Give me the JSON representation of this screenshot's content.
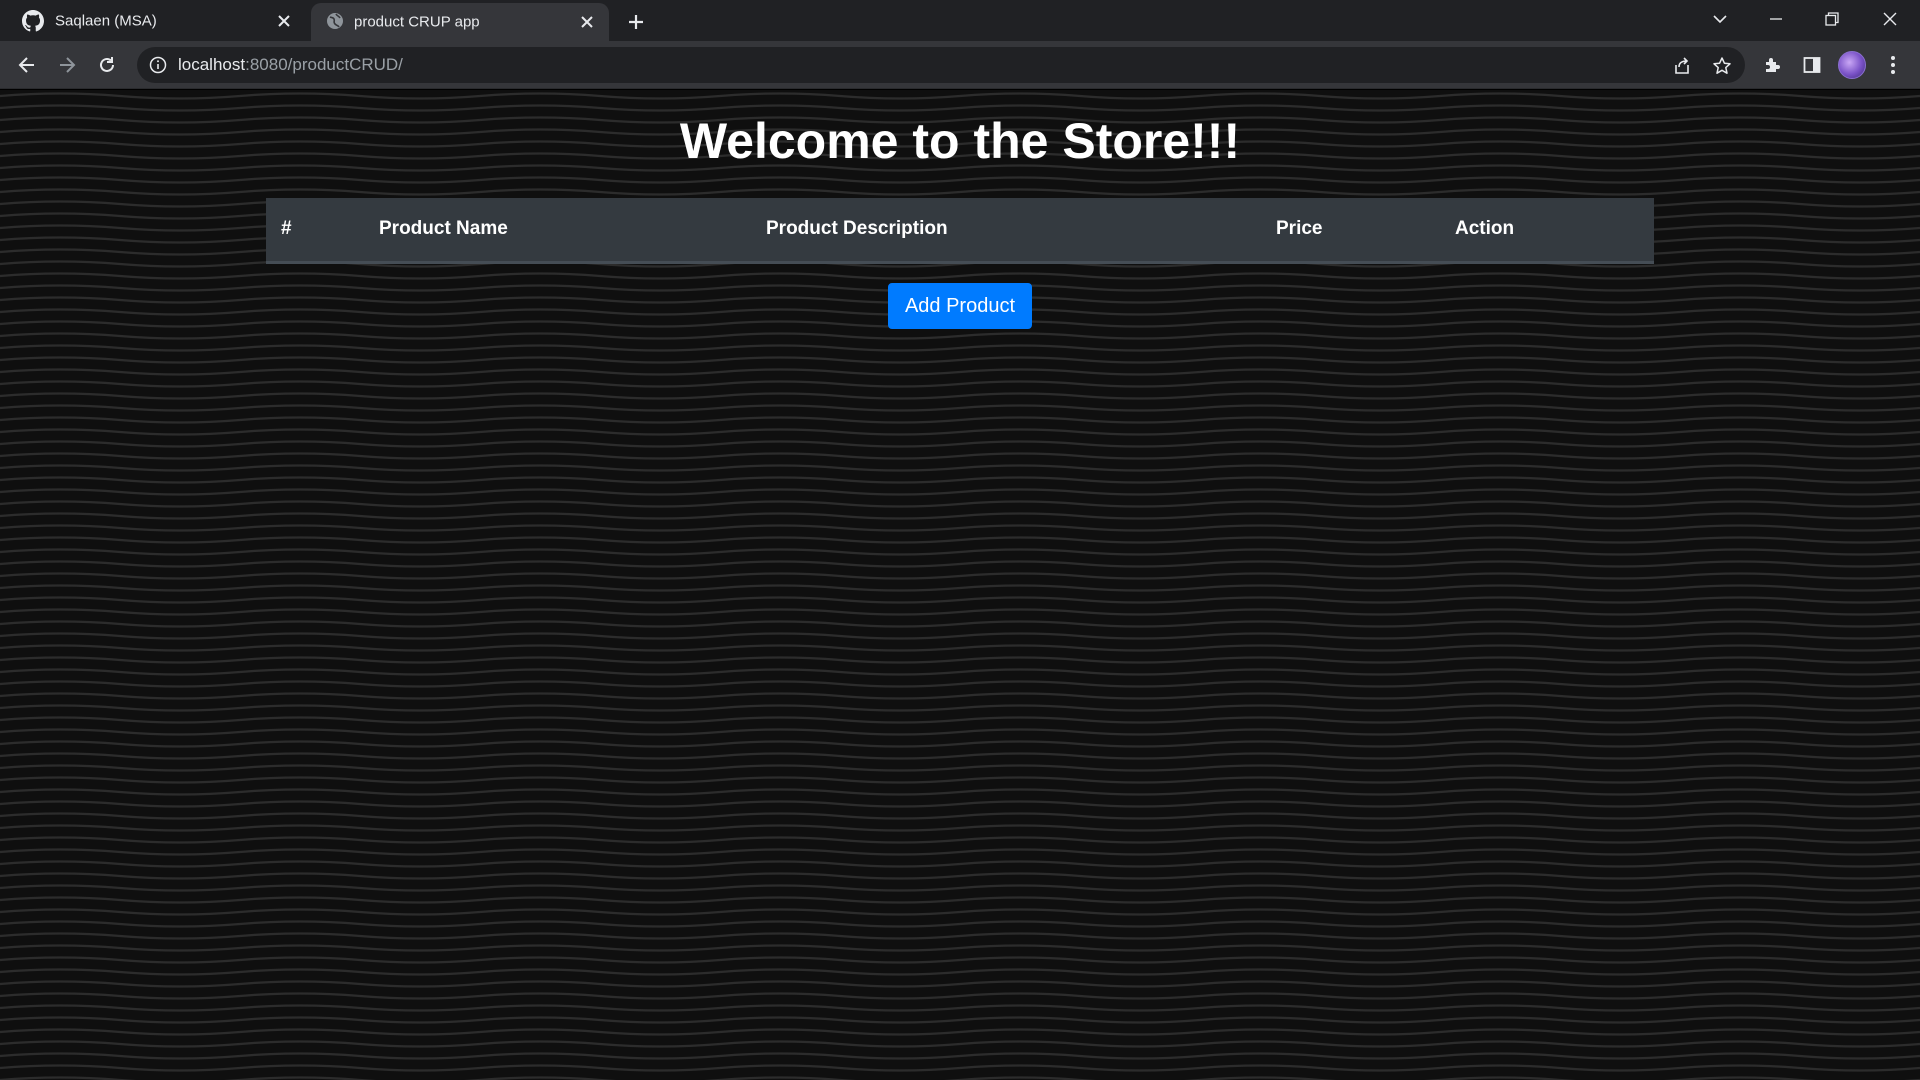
{
  "browser": {
    "tabs": [
      {
        "title": "Saqlaen (MSA)",
        "favicon": "github-icon",
        "active": false
      },
      {
        "title": "product CRUP app",
        "favicon": "globe-icon",
        "active": true
      }
    ],
    "address_bar": {
      "host": "localhost",
      "path": ":8080/productCRUD/"
    }
  },
  "page": {
    "heading": "Welcome to the Store!!!",
    "table": {
      "columns": [
        "#",
        "Product Name",
        "Product Description",
        "Price",
        "Action"
      ],
      "rows": []
    },
    "add_button_label": "Add Product"
  },
  "colors": {
    "primary_button": "#007bff",
    "table_header": "#343a40",
    "page_background": "#111111"
  }
}
